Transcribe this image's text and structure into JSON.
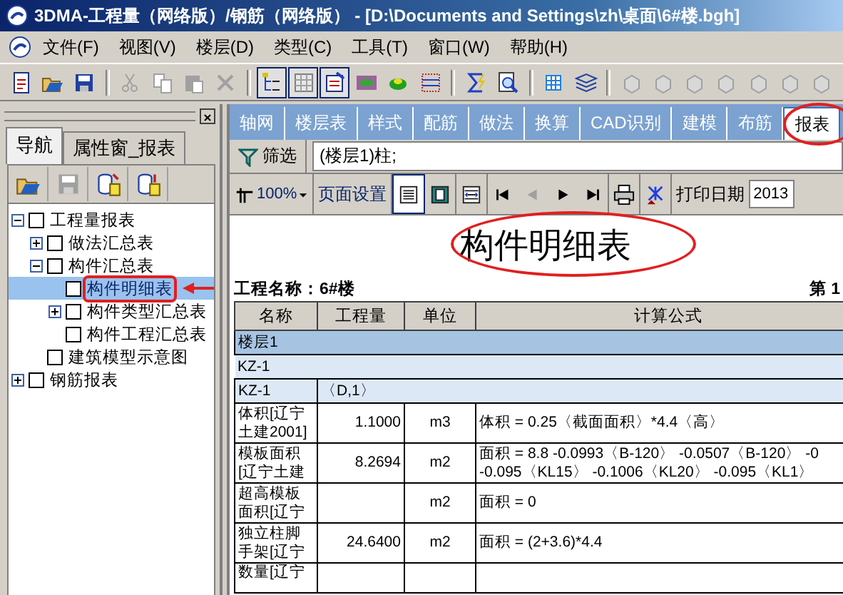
{
  "window": {
    "title": "3DMA-工程量（网络版）/钢筋（网络版） - [D:\\Documents and Settings\\zh\\桌面\\6#楼.bgh]"
  },
  "menu": [
    "文件(F)",
    "视图(V)",
    "楼层(D)",
    "类型(C)",
    "工具(T)",
    "窗口(W)",
    "帮助(H)"
  ],
  "toolbar": [
    {
      "kind": "new",
      "disabled": false,
      "pressed": false
    },
    {
      "kind": "open",
      "disabled": false,
      "pressed": false
    },
    {
      "kind": "save",
      "disabled": false,
      "pressed": false
    },
    {
      "kind": "sep"
    },
    {
      "kind": "cut",
      "disabled": true,
      "pressed": false
    },
    {
      "kind": "copy",
      "disabled": true,
      "pressed": false
    },
    {
      "kind": "paste",
      "disabled": true,
      "pressed": false
    },
    {
      "kind": "delete",
      "disabled": true,
      "pressed": false
    },
    {
      "kind": "sep"
    },
    {
      "kind": "tree",
      "disabled": false,
      "pressed": true
    },
    {
      "kind": "grid",
      "disabled": false,
      "pressed": true
    },
    {
      "kind": "props",
      "disabled": false,
      "pressed": true
    },
    {
      "kind": "eye",
      "disabled": false,
      "pressed": false
    },
    {
      "kind": "shape",
      "disabled": false,
      "pressed": false
    },
    {
      "kind": "dotted",
      "disabled": false,
      "pressed": false
    },
    {
      "kind": "sep"
    },
    {
      "kind": "sigma",
      "disabled": false,
      "pressed": false
    },
    {
      "kind": "find",
      "disabled": false,
      "pressed": false
    },
    {
      "kind": "sep"
    },
    {
      "kind": "table",
      "disabled": false,
      "pressed": false
    },
    {
      "kind": "layers",
      "disabled": false,
      "pressed": false
    },
    {
      "kind": "sep"
    },
    {
      "kind": "block",
      "disabled": true,
      "pressed": false
    },
    {
      "kind": "block",
      "disabled": true,
      "pressed": false
    },
    {
      "kind": "block",
      "disabled": true,
      "pressed": false
    },
    {
      "kind": "block",
      "disabled": true,
      "pressed": false
    },
    {
      "kind": "block",
      "disabled": true,
      "pressed": false
    },
    {
      "kind": "block",
      "disabled": true,
      "pressed": false
    },
    {
      "kind": "block",
      "disabled": true,
      "pressed": false
    }
  ],
  "side_panel": {
    "tabs": [
      {
        "label": "导航",
        "selected": true
      },
      {
        "label": "属性窗_报表",
        "selected": false
      }
    ],
    "tools": [
      {
        "kind": "open",
        "disabled": false
      },
      {
        "kind": "save",
        "disabled": true
      },
      {
        "kind": "db-in",
        "disabled": false
      },
      {
        "kind": "db-out",
        "disabled": false
      }
    ],
    "tree": [
      {
        "label": "工程量报表",
        "expanded": true,
        "checked": false,
        "selected": false,
        "children": [
          {
            "label": "做法汇总表",
            "expanded": false,
            "checked": false,
            "selected": false
          },
          {
            "label": "构件汇总表",
            "expanded": true,
            "checked": false,
            "selected": false,
            "children": [
              {
                "label": "构件明细表",
                "checked": false,
                "selected": true
              },
              {
                "label": "构件类型汇总表",
                "expanded": false,
                "checked": false,
                "selected": false
              },
              {
                "label": "构件工程汇总表",
                "checked": false,
                "selected": false
              }
            ]
          },
          {
            "label": "建筑模型示意图",
            "checked": false,
            "selected": false
          }
        ]
      },
      {
        "label": "钢筋报表",
        "expanded": false,
        "checked": false,
        "selected": false
      }
    ]
  },
  "tabs": [
    {
      "label": "轴网",
      "selected": false
    },
    {
      "label": "楼层表",
      "selected": false
    },
    {
      "label": "样式",
      "selected": false
    },
    {
      "label": "配筋",
      "selected": false
    },
    {
      "label": "做法",
      "selected": false
    },
    {
      "label": "换算",
      "selected": false
    },
    {
      "label": "CAD识别",
      "selected": false
    },
    {
      "label": "建模",
      "selected": false
    },
    {
      "label": "布筋",
      "selected": false
    },
    {
      "label": "报表",
      "selected": true
    }
  ],
  "filter": {
    "button": "筛选",
    "value": "(楼层1)柱;"
  },
  "report_toolbar": {
    "zoom": "100%",
    "page_setup": "页面设置",
    "views": [
      {
        "kind": "page",
        "selected": true
      },
      {
        "kind": "fit",
        "selected": false
      },
      {
        "kind": "width",
        "selected": false
      }
    ],
    "nav": [
      {
        "kind": "first",
        "disabled": false
      },
      {
        "kind": "prev",
        "disabled": true
      },
      {
        "kind": "next",
        "disabled": false
      },
      {
        "kind": "last",
        "disabled": false
      }
    ],
    "print_date_label": "打印日期",
    "print_date": "2013"
  },
  "report": {
    "title": "构件明细表",
    "project": "工程名称：6#楼",
    "page": "第 1",
    "columns": [
      "名称",
      "工程量",
      "单位",
      "计算公式"
    ],
    "rows": [
      {
        "kind": "group",
        "label": "楼层1"
      },
      {
        "kind": "component",
        "label": "KZ-1"
      },
      {
        "kind": "instance",
        "name": "KZ-1",
        "detail": "〈D,1〉"
      },
      {
        "kind": "item",
        "name": "体积[辽宁土建2001]",
        "quantity": "1.1000",
        "unit": "m3",
        "formula": [
          "体积 = 0.25〈截面面积〉*4.4〈高〉"
        ]
      },
      {
        "kind": "item",
        "name": "模板面积[辽宁土建",
        "quantity": "8.2694",
        "unit": "m2",
        "formula": [
          "面积 = 8.8 -0.0993〈B-120〉 -0.0507〈B-120〉 -0",
          "-0.095〈KL15〉 -0.1006〈KL20〉 -0.095〈KL1〉"
        ]
      },
      {
        "kind": "item",
        "name": "超高模板面积[辽宁",
        "unit": "m2",
        "formula": [
          "面积 = 0"
        ]
      },
      {
        "kind": "item",
        "name": "独立柱脚手架[辽宁",
        "quantity": "24.6400",
        "unit": "m2",
        "formula": [
          "面积 = (2+3.6)*4.4"
        ]
      },
      {
        "kind": "item",
        "name": "数量[辽宁"
      }
    ]
  }
}
